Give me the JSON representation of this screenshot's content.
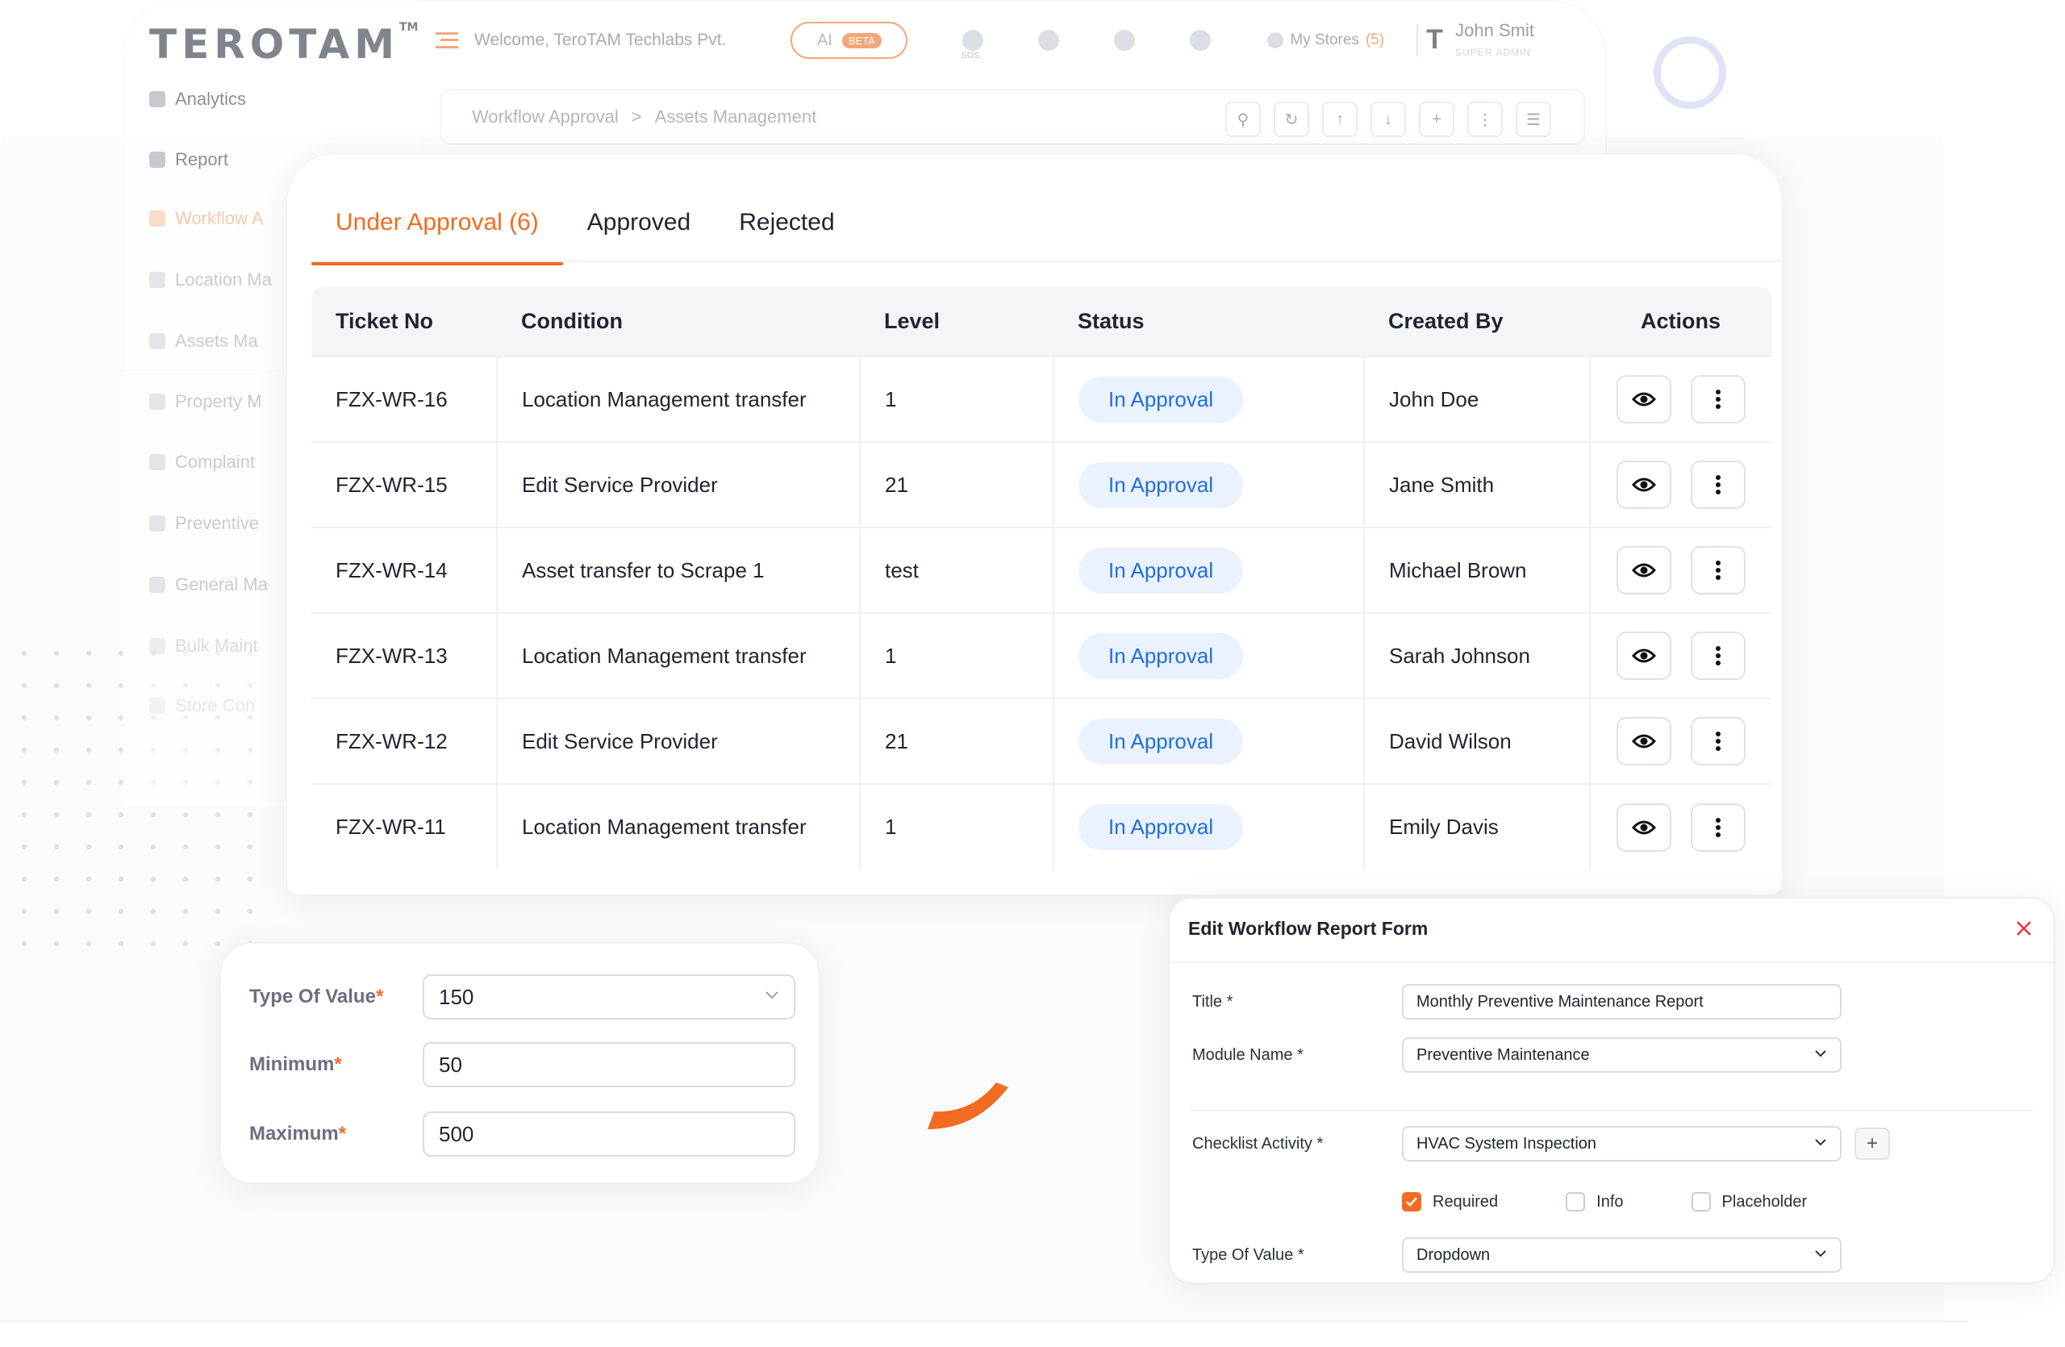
{
  "colors": {
    "accent": "#f26b21",
    "status_bg": "#eaf2ff",
    "status_text": "#1e6fe0",
    "close": "#e53935"
  },
  "app": {
    "logo": "TEROTAM",
    "logo_tm": "TM",
    "welcome": "Welcome, TeroTAM Techlabs Pvt.",
    "ai_label": "AI",
    "beta_label": "BETA",
    "sos_label": "SOS",
    "stores_label": "My Stores",
    "stores_count": "(5)",
    "user_name": "John Smit",
    "user_role": "SUPER ADMIN",
    "user_initial": "T"
  },
  "sidebar": {
    "items": [
      {
        "label": "Analytics",
        "icon": "chart-icon"
      },
      {
        "label": "Report",
        "icon": "report-icon"
      },
      {
        "label": "Workflow A",
        "icon": "workflow-icon"
      },
      {
        "label": "Location Ma",
        "icon": "location-icon"
      },
      {
        "label": "Assets Ma",
        "icon": "assets-icon"
      },
      {
        "label": "Property M",
        "icon": "property-icon"
      },
      {
        "label": "Complaint",
        "icon": "complaint-icon"
      },
      {
        "label": "Preventive",
        "icon": "preventive-icon"
      },
      {
        "label": "General Ma",
        "icon": "general-icon"
      },
      {
        "label": "Bulk Maint",
        "icon": "bulk-icon"
      },
      {
        "label": "Store Con",
        "icon": "store-icon"
      }
    ]
  },
  "breadcrumb": {
    "root": "Workflow Approval",
    "separator": ">",
    "current": "Assets Management"
  },
  "tabs": [
    {
      "label": "Under Approval (6)",
      "active": true
    },
    {
      "label": "Approved",
      "active": false
    },
    {
      "label": "Rejected",
      "active": false
    }
  ],
  "table": {
    "columns": [
      "Ticket No",
      "Condition",
      "Level",
      "Status",
      "Created By",
      "Actions"
    ],
    "rows": [
      {
        "ticket": "FZX-WR-16",
        "condition": "Location Management transfer",
        "level": "1",
        "status": "In Approval",
        "created_by": "John Doe"
      },
      {
        "ticket": "FZX-WR-15",
        "condition": "Edit Service Provider",
        "level": "21",
        "status": "In Approval",
        "created_by": "Jane Smith"
      },
      {
        "ticket": "FZX-WR-14",
        "condition": "Asset transfer to Scrape 1",
        "level": "test",
        "status": "In Approval",
        "created_by": "Michael Brown"
      },
      {
        "ticket": "FZX-WR-13",
        "condition": "Location Management transfer",
        "level": "1",
        "status": "In Approval",
        "created_by": "Sarah Johnson"
      },
      {
        "ticket": "FZX-WR-12",
        "condition": "Edit Service Provider",
        "level": "21",
        "status": "In Approval",
        "created_by": "David Wilson"
      },
      {
        "ticket": "FZX-WR-11",
        "condition": "Location Management transfer",
        "level": "1",
        "status": "In Approval",
        "created_by": "Emily Davis"
      }
    ]
  },
  "value_form": {
    "type_label": "Type Of Value",
    "type_value": "150",
    "min_label": "Minimum",
    "min_value": "50",
    "max_label": "Maximum",
    "max_value": "500",
    "required_mark": "*"
  },
  "edit_form": {
    "heading": "Edit Workflow Report Form",
    "title_label": "Title",
    "title_value": "Monthly Preventive Maintenance Report",
    "module_label": "Module Name",
    "module_value": "Preventive Maintenance",
    "checklist_label": "Checklist Activity",
    "checklist_value": "HVAC System Inspection",
    "add_symbol": "+",
    "required_label": "Required",
    "required_checked": true,
    "info_label": "Info",
    "info_checked": false,
    "placeholder_label": "Placeholder",
    "placeholder_checked": false,
    "type_label": "Type Of Value",
    "type_value": "Dropdown",
    "required_mark": "*"
  }
}
